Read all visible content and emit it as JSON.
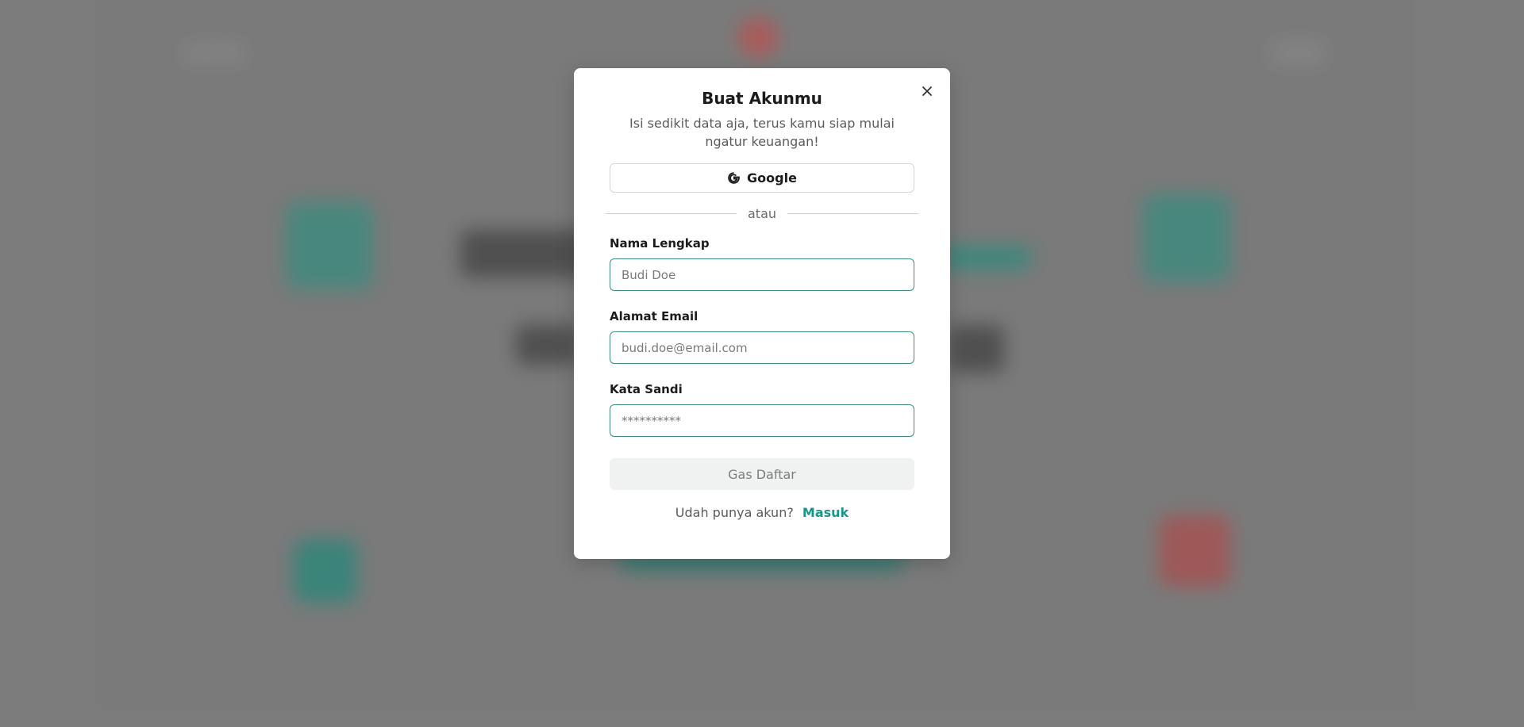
{
  "modal": {
    "title": "Buat Akunmu",
    "subtitle": "Isi sedikit data aja, terus kamu siap mulai ngatur keuangan!",
    "google_label": "Google",
    "divider_label": "atau",
    "fields": [
      {
        "label": "Nama Lengkap",
        "placeholder": "Budi Doe",
        "type": "text"
      },
      {
        "label": "Alamat Email",
        "placeholder": "budi.doe@email.com",
        "type": "email"
      },
      {
        "label": "Kata Sandi",
        "placeholder": "**********",
        "type": "password"
      }
    ],
    "submit_label": "Gas Daftar",
    "footer_text": "Udah punya akun?",
    "footer_link": "Masuk"
  },
  "colors": {
    "accent": "#16978a",
    "input_border": "#3e8f7e",
    "backdrop": "#7c7c7c"
  },
  "icons": {
    "close": "close-icon",
    "google": "google-icon"
  }
}
